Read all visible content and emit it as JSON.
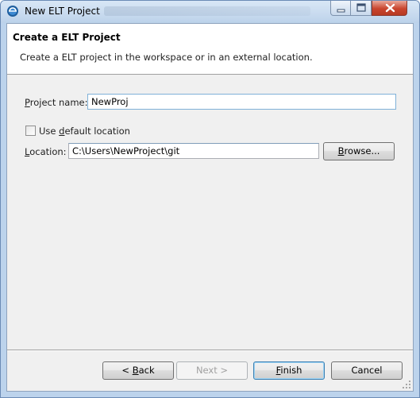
{
  "window": {
    "title": "New ELT Project"
  },
  "header": {
    "title": "Create a ELT Project",
    "description": "Create a ELT project in the workspace or in an external location."
  },
  "form": {
    "project_name": {
      "label_underlined": "P",
      "label_rest": "roject name:",
      "value": "NewProj"
    },
    "use_default_location": {
      "label_before": "Use ",
      "label_underlined": "d",
      "label_rest": "efault location",
      "checked": false
    },
    "location": {
      "label_underlined": "L",
      "label_rest": "ocation:",
      "value": "C:\\Users\\NewProject\\git"
    },
    "browse_button": {
      "label_underlined": "B",
      "label_rest": "rowse..."
    }
  },
  "footer": {
    "back": {
      "prefix": "< ",
      "underlined": "B",
      "rest": "ack",
      "enabled": true
    },
    "next": {
      "label": "Next >",
      "enabled": false
    },
    "finish": {
      "underlined": "F",
      "rest": "inish",
      "enabled": true,
      "default": true
    },
    "cancel": {
      "label": "Cancel",
      "enabled": true
    }
  },
  "colors": {
    "titlebar": "#bcd3ec",
    "close_button": "#c9452e",
    "dialog_background": "#f0f0f0",
    "focus_border": "#7fb1d8"
  },
  "icons": {
    "app": "eclipse-app-icon",
    "minimize": "minimize-icon",
    "maximize": "maximize-icon",
    "close": "close-icon",
    "resize": "resize-grip-icon"
  }
}
